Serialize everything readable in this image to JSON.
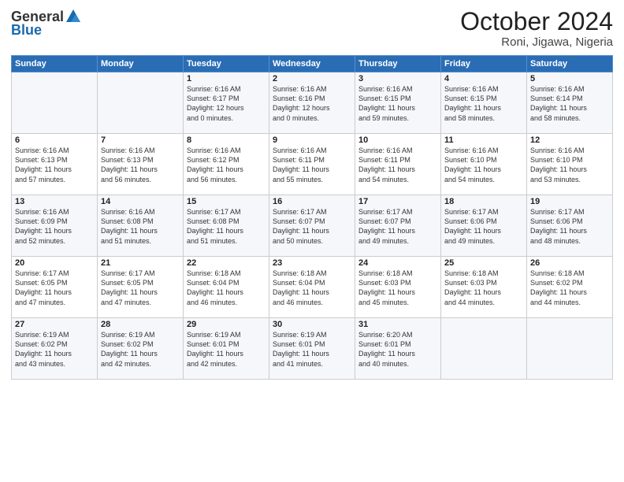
{
  "logo": {
    "general": "General",
    "blue": "Blue"
  },
  "title": "October 2024",
  "subtitle": "Roni, Jigawa, Nigeria",
  "headers": [
    "Sunday",
    "Monday",
    "Tuesday",
    "Wednesday",
    "Thursday",
    "Friday",
    "Saturday"
  ],
  "weeks": [
    [
      {
        "day": "",
        "lines": []
      },
      {
        "day": "",
        "lines": []
      },
      {
        "day": "1",
        "lines": [
          "Sunrise: 6:16 AM",
          "Sunset: 6:17 PM",
          "Daylight: 12 hours",
          "and 0 minutes."
        ]
      },
      {
        "day": "2",
        "lines": [
          "Sunrise: 6:16 AM",
          "Sunset: 6:16 PM",
          "Daylight: 12 hours",
          "and 0 minutes."
        ]
      },
      {
        "day": "3",
        "lines": [
          "Sunrise: 6:16 AM",
          "Sunset: 6:15 PM",
          "Daylight: 11 hours",
          "and 59 minutes."
        ]
      },
      {
        "day": "4",
        "lines": [
          "Sunrise: 6:16 AM",
          "Sunset: 6:15 PM",
          "Daylight: 11 hours",
          "and 58 minutes."
        ]
      },
      {
        "day": "5",
        "lines": [
          "Sunrise: 6:16 AM",
          "Sunset: 6:14 PM",
          "Daylight: 11 hours",
          "and 58 minutes."
        ]
      }
    ],
    [
      {
        "day": "6",
        "lines": [
          "Sunrise: 6:16 AM",
          "Sunset: 6:13 PM",
          "Daylight: 11 hours",
          "and 57 minutes."
        ]
      },
      {
        "day": "7",
        "lines": [
          "Sunrise: 6:16 AM",
          "Sunset: 6:13 PM",
          "Daylight: 11 hours",
          "and 56 minutes."
        ]
      },
      {
        "day": "8",
        "lines": [
          "Sunrise: 6:16 AM",
          "Sunset: 6:12 PM",
          "Daylight: 11 hours",
          "and 56 minutes."
        ]
      },
      {
        "day": "9",
        "lines": [
          "Sunrise: 6:16 AM",
          "Sunset: 6:11 PM",
          "Daylight: 11 hours",
          "and 55 minutes."
        ]
      },
      {
        "day": "10",
        "lines": [
          "Sunrise: 6:16 AM",
          "Sunset: 6:11 PM",
          "Daylight: 11 hours",
          "and 54 minutes."
        ]
      },
      {
        "day": "11",
        "lines": [
          "Sunrise: 6:16 AM",
          "Sunset: 6:10 PM",
          "Daylight: 11 hours",
          "and 54 minutes."
        ]
      },
      {
        "day": "12",
        "lines": [
          "Sunrise: 6:16 AM",
          "Sunset: 6:10 PM",
          "Daylight: 11 hours",
          "and 53 minutes."
        ]
      }
    ],
    [
      {
        "day": "13",
        "lines": [
          "Sunrise: 6:16 AM",
          "Sunset: 6:09 PM",
          "Daylight: 11 hours",
          "and 52 minutes."
        ]
      },
      {
        "day": "14",
        "lines": [
          "Sunrise: 6:16 AM",
          "Sunset: 6:08 PM",
          "Daylight: 11 hours",
          "and 51 minutes."
        ]
      },
      {
        "day": "15",
        "lines": [
          "Sunrise: 6:17 AM",
          "Sunset: 6:08 PM",
          "Daylight: 11 hours",
          "and 51 minutes."
        ]
      },
      {
        "day": "16",
        "lines": [
          "Sunrise: 6:17 AM",
          "Sunset: 6:07 PM",
          "Daylight: 11 hours",
          "and 50 minutes."
        ]
      },
      {
        "day": "17",
        "lines": [
          "Sunrise: 6:17 AM",
          "Sunset: 6:07 PM",
          "Daylight: 11 hours",
          "and 49 minutes."
        ]
      },
      {
        "day": "18",
        "lines": [
          "Sunrise: 6:17 AM",
          "Sunset: 6:06 PM",
          "Daylight: 11 hours",
          "and 49 minutes."
        ]
      },
      {
        "day": "19",
        "lines": [
          "Sunrise: 6:17 AM",
          "Sunset: 6:06 PM",
          "Daylight: 11 hours",
          "and 48 minutes."
        ]
      }
    ],
    [
      {
        "day": "20",
        "lines": [
          "Sunrise: 6:17 AM",
          "Sunset: 6:05 PM",
          "Daylight: 11 hours",
          "and 47 minutes."
        ]
      },
      {
        "day": "21",
        "lines": [
          "Sunrise: 6:17 AM",
          "Sunset: 6:05 PM",
          "Daylight: 11 hours",
          "and 47 minutes."
        ]
      },
      {
        "day": "22",
        "lines": [
          "Sunrise: 6:18 AM",
          "Sunset: 6:04 PM",
          "Daylight: 11 hours",
          "and 46 minutes."
        ]
      },
      {
        "day": "23",
        "lines": [
          "Sunrise: 6:18 AM",
          "Sunset: 6:04 PM",
          "Daylight: 11 hours",
          "and 46 minutes."
        ]
      },
      {
        "day": "24",
        "lines": [
          "Sunrise: 6:18 AM",
          "Sunset: 6:03 PM",
          "Daylight: 11 hours",
          "and 45 minutes."
        ]
      },
      {
        "day": "25",
        "lines": [
          "Sunrise: 6:18 AM",
          "Sunset: 6:03 PM",
          "Daylight: 11 hours",
          "and 44 minutes."
        ]
      },
      {
        "day": "26",
        "lines": [
          "Sunrise: 6:18 AM",
          "Sunset: 6:02 PM",
          "Daylight: 11 hours",
          "and 44 minutes."
        ]
      }
    ],
    [
      {
        "day": "27",
        "lines": [
          "Sunrise: 6:19 AM",
          "Sunset: 6:02 PM",
          "Daylight: 11 hours",
          "and 43 minutes."
        ]
      },
      {
        "day": "28",
        "lines": [
          "Sunrise: 6:19 AM",
          "Sunset: 6:02 PM",
          "Daylight: 11 hours",
          "and 42 minutes."
        ]
      },
      {
        "day": "29",
        "lines": [
          "Sunrise: 6:19 AM",
          "Sunset: 6:01 PM",
          "Daylight: 11 hours",
          "and 42 minutes."
        ]
      },
      {
        "day": "30",
        "lines": [
          "Sunrise: 6:19 AM",
          "Sunset: 6:01 PM",
          "Daylight: 11 hours",
          "and 41 minutes."
        ]
      },
      {
        "day": "31",
        "lines": [
          "Sunrise: 6:20 AM",
          "Sunset: 6:01 PM",
          "Daylight: 11 hours",
          "and 40 minutes."
        ]
      },
      {
        "day": "",
        "lines": []
      },
      {
        "day": "",
        "lines": []
      }
    ]
  ]
}
